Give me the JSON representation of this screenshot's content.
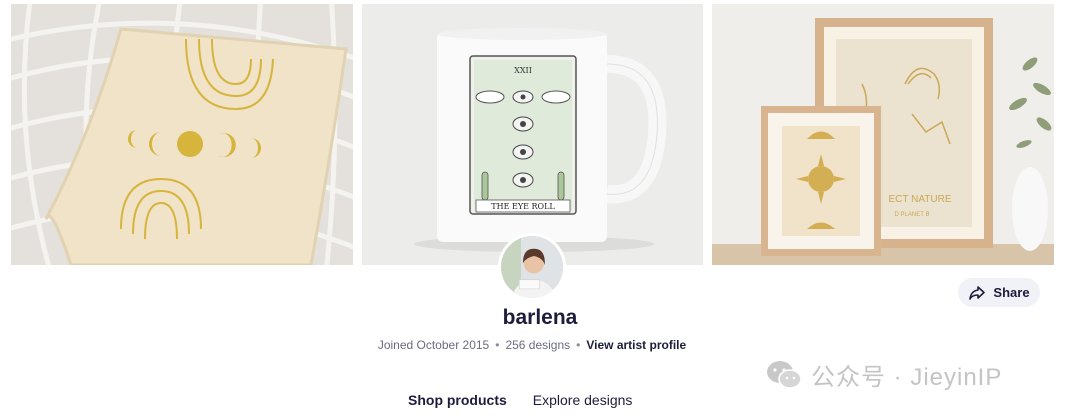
{
  "banner": {
    "images": [
      {
        "alt": "Moon phase pillow"
      },
      {
        "alt": "Tarot eye roll mug"
      },
      {
        "alt": "Nature framed prints"
      }
    ],
    "mug_card_numeral": "XXII",
    "mug_card_caption": "THE EYE ROLL",
    "poster_text": "ECT NATURE",
    "poster_subtext": "D PLANET B"
  },
  "profile": {
    "username": "barlena",
    "joined": "Joined October 2015",
    "designs": "256 designs",
    "view_profile": "View artist profile"
  },
  "share": {
    "label": "Share",
    "icon": "share-arrow-icon"
  },
  "tabs": [
    {
      "label": "Shop products",
      "active": true
    },
    {
      "label": "Explore designs",
      "active": false
    }
  ],
  "watermark": {
    "text": "公众号 · JieyinIP",
    "icon": "wechat-icon"
  },
  "colors": {
    "text_primary": "#1d1d3b",
    "text_secondary": "#6b6b80",
    "share_bg": "#f1f2f7",
    "gold": "#d7b43c"
  }
}
